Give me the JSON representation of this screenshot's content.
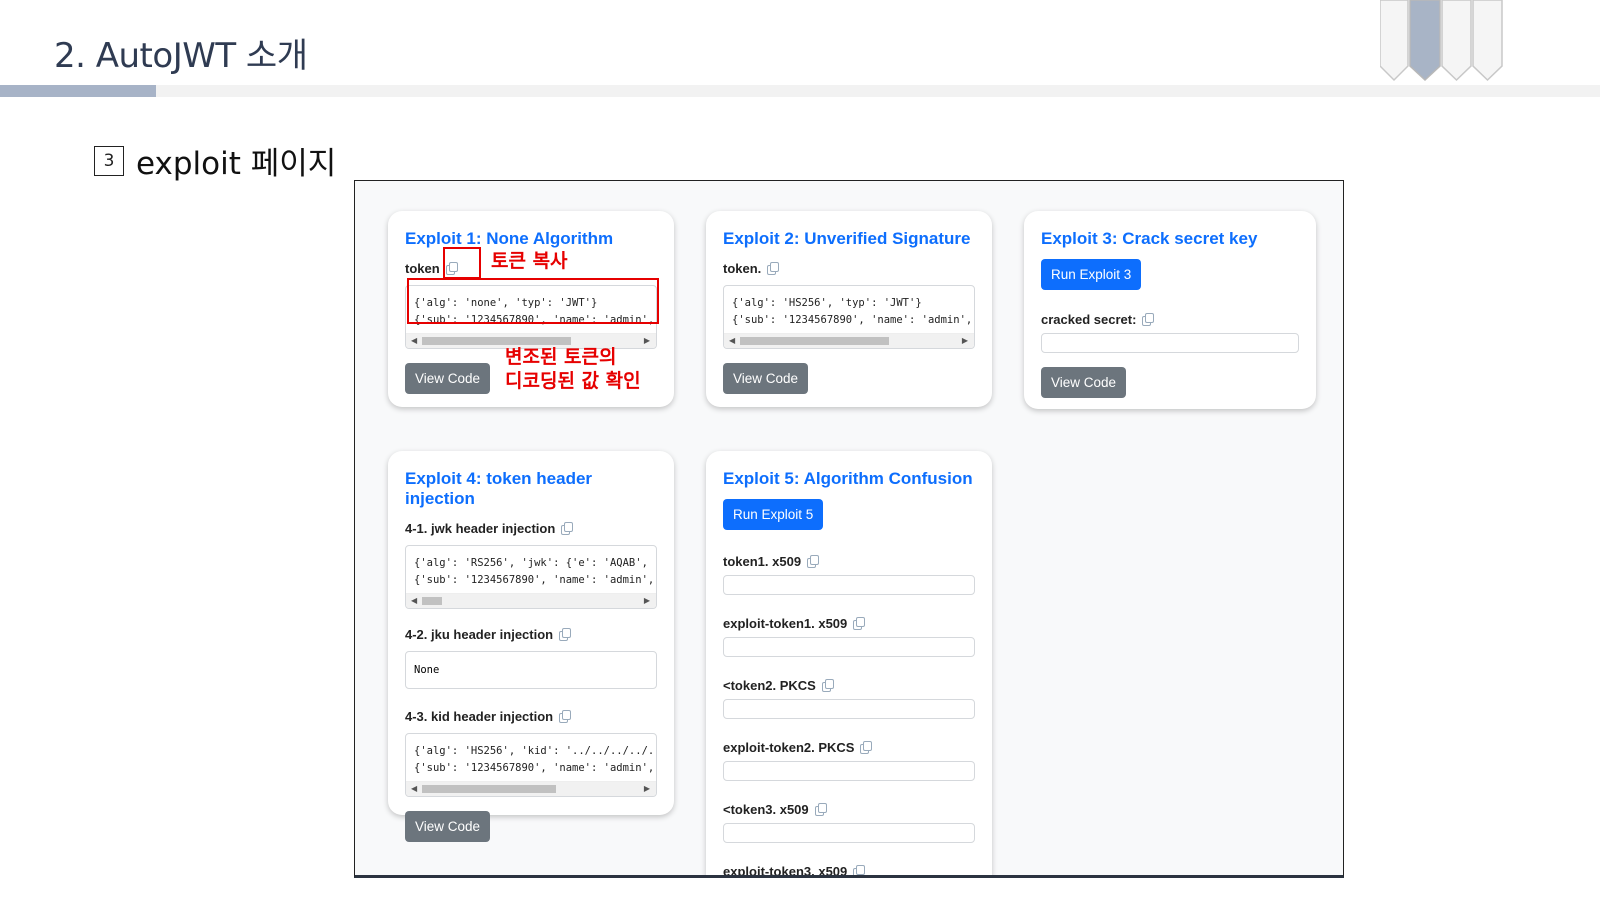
{
  "slide": {
    "title": "2. AutoJWT 소개",
    "section_number": "3",
    "section_label": "exploit 페이지"
  },
  "annotations": {
    "copy_token": "토큰 복사",
    "decoded_line1": "변조된 토큰의",
    "decoded_line2": "디코딩된 값 확인"
  },
  "cards": {
    "e1": {
      "title": "Exploit 1: None Algorithm",
      "token_label": "token",
      "code_line1": "{'alg': 'none', 'typ': 'JWT'}",
      "code_line2": "{'sub': '1234567890', 'name': 'admin',",
      "view_code": "View Code"
    },
    "e2": {
      "title": "Exploit 2: Unverified Signature",
      "token_label": "token.",
      "code_line1": "{'alg': 'HS256', 'typ': 'JWT'}",
      "code_line2": "{'sub': '1234567890', 'name': 'admin',",
      "view_code": "View Code"
    },
    "e3": {
      "title": "Exploit 3: Crack secret key",
      "run_label": "Run Exploit 3",
      "cracked_label": "cracked secret:",
      "view_code": "View Code"
    },
    "e4": {
      "title": "Exploit 4: token header injection",
      "jwk_label": "4-1. jwk header injection",
      "jwk_line1": "{'alg': 'RS256', 'jwk': {'e': 'AQAB',",
      "jwk_line2": "{'sub': '1234567890', 'name': 'admin',",
      "jku_label": "4-2. jku header injection",
      "jku_value": "None",
      "kid_label": "4-3. kid header injection",
      "kid_line1": "{'alg': 'HS256', 'kid': '../../../../.",
      "kid_line2": "{'sub': '1234567890', 'name': 'admin',",
      "view_code": "View Code"
    },
    "e5": {
      "title": "Exploit 5: Algorithm Confusion",
      "run_label": "Run Exploit 5",
      "fields": [
        "token1. x509",
        "exploit-token1. x509",
        "<token2. PKCS",
        "exploit-token2. PKCS",
        "<token3. x509",
        "exploit-token3. x509"
      ]
    }
  },
  "colors": {
    "link_blue": "#0d6efd",
    "button_gray": "#6c757d",
    "annotation_red": "#e60000",
    "title_text": "#2f3b52"
  }
}
